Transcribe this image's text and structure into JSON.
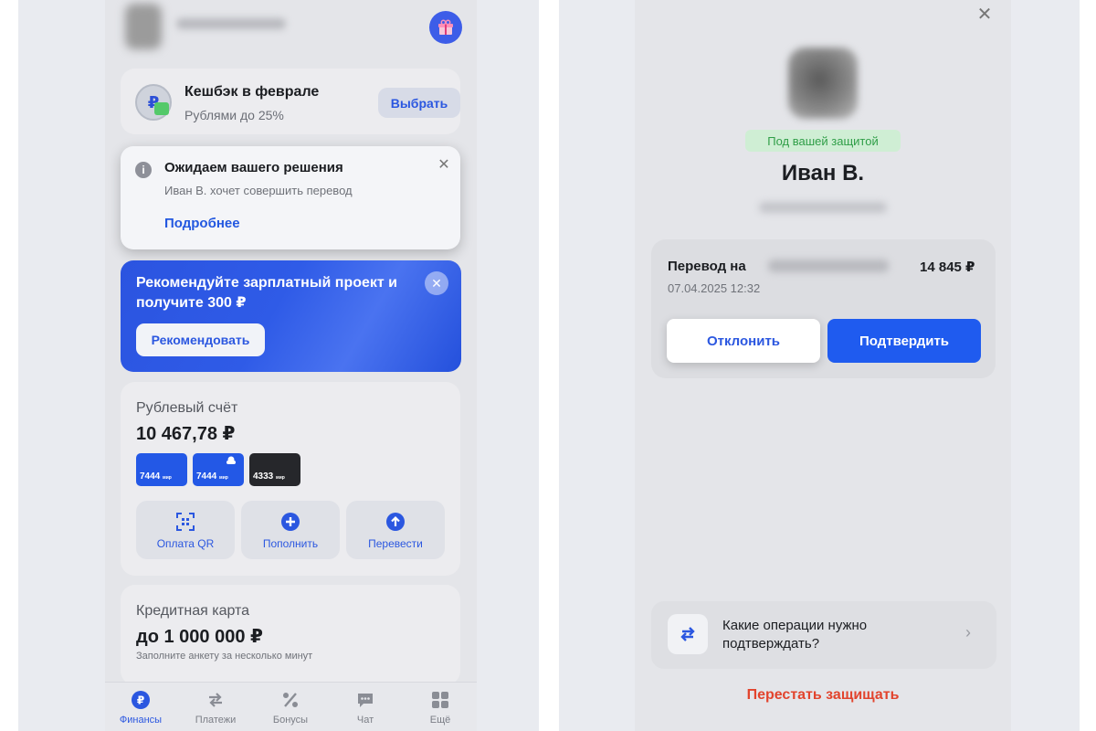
{
  "left": {
    "cashback": {
      "title": "Кешбэк в феврале",
      "subtitle": "Рублями до 25%",
      "coin_symbol": "₽",
      "button_label": "Выбрать"
    },
    "notice": {
      "title": "Ожидаем вашего решения",
      "subtitle": "Иван В. хочет совершить перевод",
      "link_label": "Подробнее",
      "close_label": "✕"
    },
    "promo": {
      "title": "Рекомендуйте зарплатный проект и получите 300 ₽",
      "close_label": "✕",
      "button_label": "Рекомендовать"
    },
    "account": {
      "title": "Рублевый счёт",
      "balance": "10 467,78 ₽",
      "cards": [
        {
          "number": "7444",
          "system": "мир",
          "color": "#2358e6"
        },
        {
          "number": "7444",
          "system": "мир",
          "color": "#2358e6"
        },
        {
          "number": "4333",
          "system": "мир",
          "color": "#26272b"
        }
      ],
      "actions": [
        {
          "label": "Оплата QR",
          "icon": "qr-scan-icon"
        },
        {
          "label": "Пополнить",
          "icon": "plus-circle-icon"
        },
        {
          "label": "Перевести",
          "icon": "arrow-up-circle-icon"
        }
      ]
    },
    "credit": {
      "title": "Кредитная карта",
      "amount": "до 1 000 000 ₽",
      "subtitle": "Заполните анкету за несколько минут"
    },
    "tabs": [
      {
        "label": "Финансы",
        "icon": "ruble-circle-icon",
        "active": true
      },
      {
        "label": "Платежи",
        "icon": "transfer-arrows-icon",
        "active": false
      },
      {
        "label": "Бонусы",
        "icon": "percent-icon",
        "active": false
      },
      {
        "label": "Чат",
        "icon": "chat-icon",
        "active": false
      },
      {
        "label": "Ещё",
        "icon": "grid-icon",
        "active": false
      }
    ]
  },
  "right": {
    "close_label": "✕",
    "badge": "Под вашей защитой",
    "name": "Иван В.",
    "transfer": {
      "label": "Перевод на",
      "amount": "14 845 ₽",
      "date": "07.04.2025 12:32"
    },
    "decline_label": "Отклонить",
    "confirm_label": "Подтвердить",
    "faq": {
      "text": "Какие операции нужно подтверждать?",
      "chevron": "›"
    },
    "stop_label": "Перестать защищать"
  },
  "colors": {
    "accent": "#2b57e0",
    "confirm": "#1f5bef",
    "danger": "#e2442d",
    "badge_bg": "#cfeed4",
    "badge_text": "#2f9e47"
  }
}
